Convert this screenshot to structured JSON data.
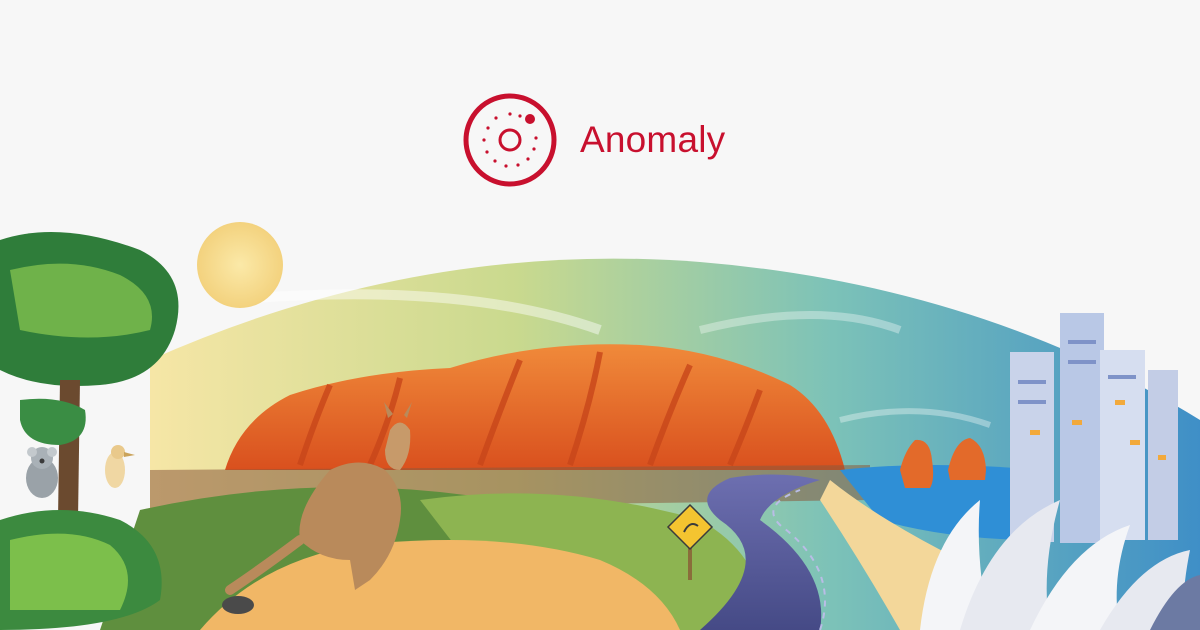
{
  "brand": {
    "name": "Anomaly",
    "icon": "anomaly-orbit-icon",
    "color": "#c8102e"
  },
  "colors": {
    "background": "#f7f7f7",
    "rock": "#e8672a",
    "sky_teal": "#5fb3b3",
    "sand": "#f1b766",
    "road": "#5b5f9c",
    "ocean": "#2f8fd6"
  }
}
